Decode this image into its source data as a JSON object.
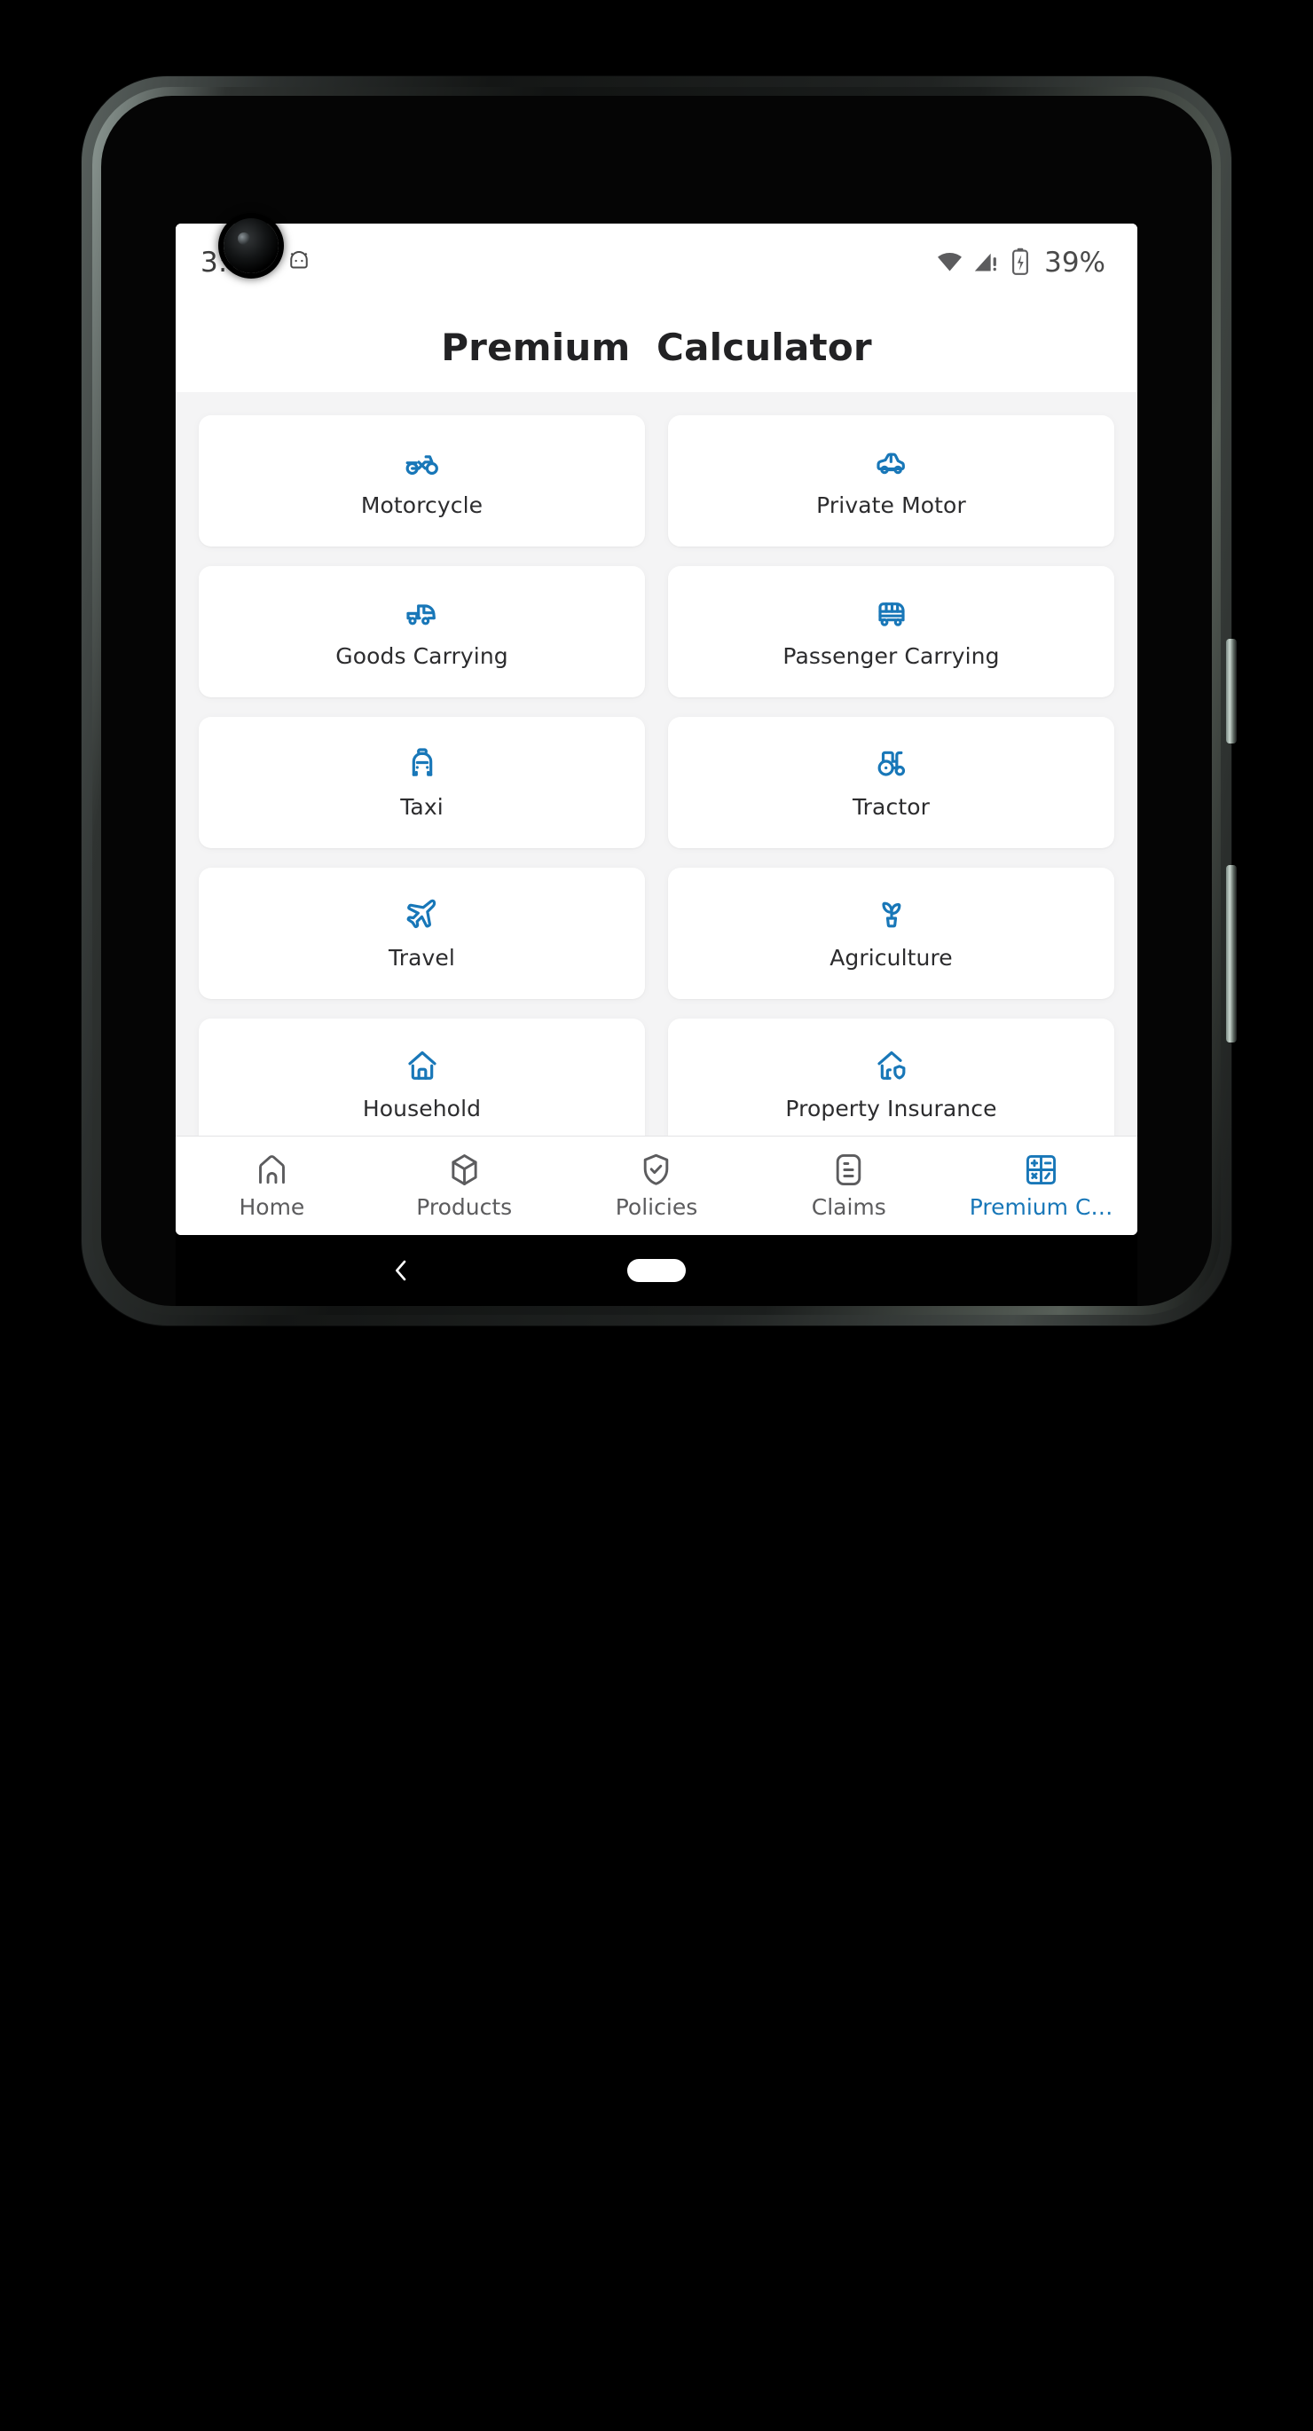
{
  "status_bar": {
    "time": "3:47",
    "android_icon": "android-icon",
    "wifi_icon": "wifi-icon",
    "cellular_icon": "cellular-signal-warning-icon",
    "battery_icon": "battery-charging-icon",
    "battery_percent": "39%"
  },
  "header": {
    "title": "Premium  Calculator"
  },
  "colors": {
    "accent": "#1877b8",
    "page_background": "#f4f4f5",
    "card_background": "#ffffff",
    "title_text": "#222224",
    "label_text": "#2c2c2e",
    "nav_inactive": "#5c5c5e"
  },
  "grid": {
    "cards": [
      {
        "label": "Motorcycle",
        "icon": "motorcycle-icon"
      },
      {
        "label": "Private Motor",
        "icon": "car-icon"
      },
      {
        "label": "Goods Carrying",
        "icon": "truck-icon"
      },
      {
        "label": "Passenger Carrying",
        "icon": "bus-icon"
      },
      {
        "label": "Taxi",
        "icon": "taxi-icon"
      },
      {
        "label": "Tractor",
        "icon": "tractor-icon"
      },
      {
        "label": "Travel",
        "icon": "airplane-icon"
      },
      {
        "label": "Agriculture",
        "icon": "seedling-plant-icon"
      },
      {
        "label": "Household",
        "icon": "home-icon"
      },
      {
        "label": "Property Insurance",
        "icon": "home-shield-icon"
      }
    ]
  },
  "bottom_nav": {
    "items": [
      {
        "label": "Home",
        "icon": "home-icon",
        "active": false
      },
      {
        "label": "Products",
        "icon": "box-3d-icon",
        "active": false
      },
      {
        "label": "Policies",
        "icon": "shield-check-icon",
        "active": false
      },
      {
        "label": "Claims",
        "icon": "document-list-icon",
        "active": false
      },
      {
        "label": "Premium C…",
        "icon": "calculator-icon",
        "active": true
      }
    ]
  },
  "system_nav": {
    "back_icon": "chevron-left-icon",
    "home_pill_icon": "home-pill-icon"
  }
}
